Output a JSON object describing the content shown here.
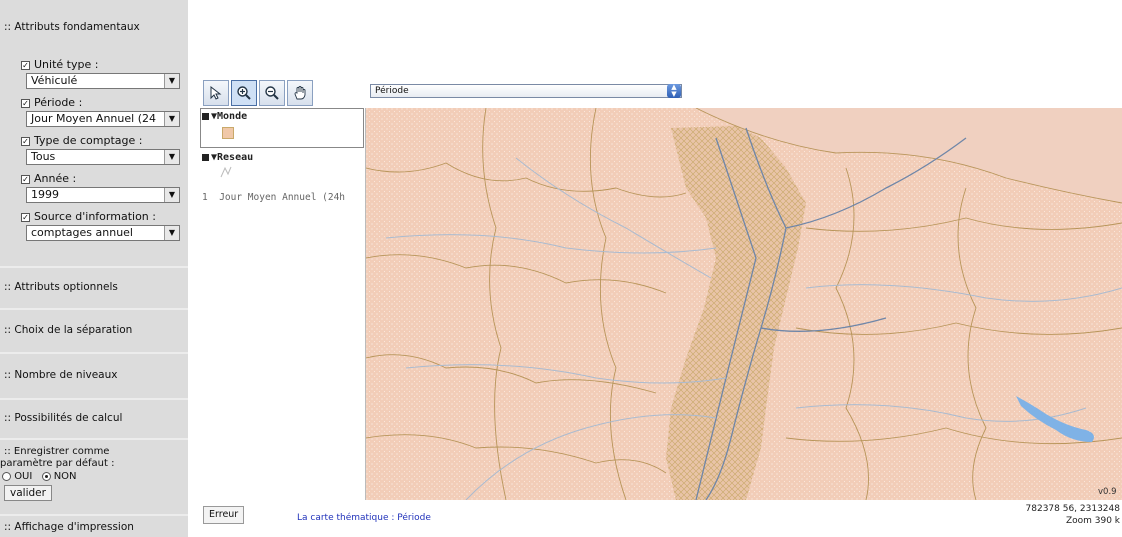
{
  "sidebar": {
    "main_section": ":: Attributs fondamentaux",
    "fields": [
      {
        "label": "Unité type :",
        "value": "Véhiculé"
      },
      {
        "label": "Période :",
        "value": "Jour Moyen Annuel (24"
      },
      {
        "label": "Type de comptage :",
        "value": "Tous"
      },
      {
        "label": "Année :",
        "value": "1999"
      },
      {
        "label": "Source d'information :",
        "value": "comptages annuel"
      }
    ],
    "sections": [
      ":: Attributs optionnels",
      ":: Choix de la séparation",
      ":: Nombre de niveaux",
      ":: Possibilités de calcul"
    ],
    "save_default": {
      "line1": ":: Enregistrer comme",
      "line2": "paramètre par défaut :",
      "oui": "OUI",
      "non": "NON",
      "selected": "NON",
      "button": "valider"
    },
    "print_section": ":: Affichage d'impression"
  },
  "toolbar": {
    "tools": [
      "select-arrow-icon",
      "zoom-in-icon",
      "zoom-out-icon",
      "pan-hand-icon"
    ],
    "active_tool": "zoom-in-icon",
    "period_select": "Période"
  },
  "legend": {
    "groups": [
      {
        "name": "▼Monde"
      },
      {
        "name": "▼Reseau"
      }
    ],
    "item": "Jour Moyen Annuel (24h",
    "item_index": "1"
  },
  "status": {
    "error_button": "Erreur",
    "message": "La carte thématique : Période",
    "coords": "782378 56, 2313248",
    "zoom": "Zoom  390 k",
    "version": "v0.9"
  },
  "colors": {
    "map_bg": "#f2cdb8",
    "network": "#6f86a8",
    "borders": "#c9a96a",
    "lake": "#7fb2e6"
  }
}
